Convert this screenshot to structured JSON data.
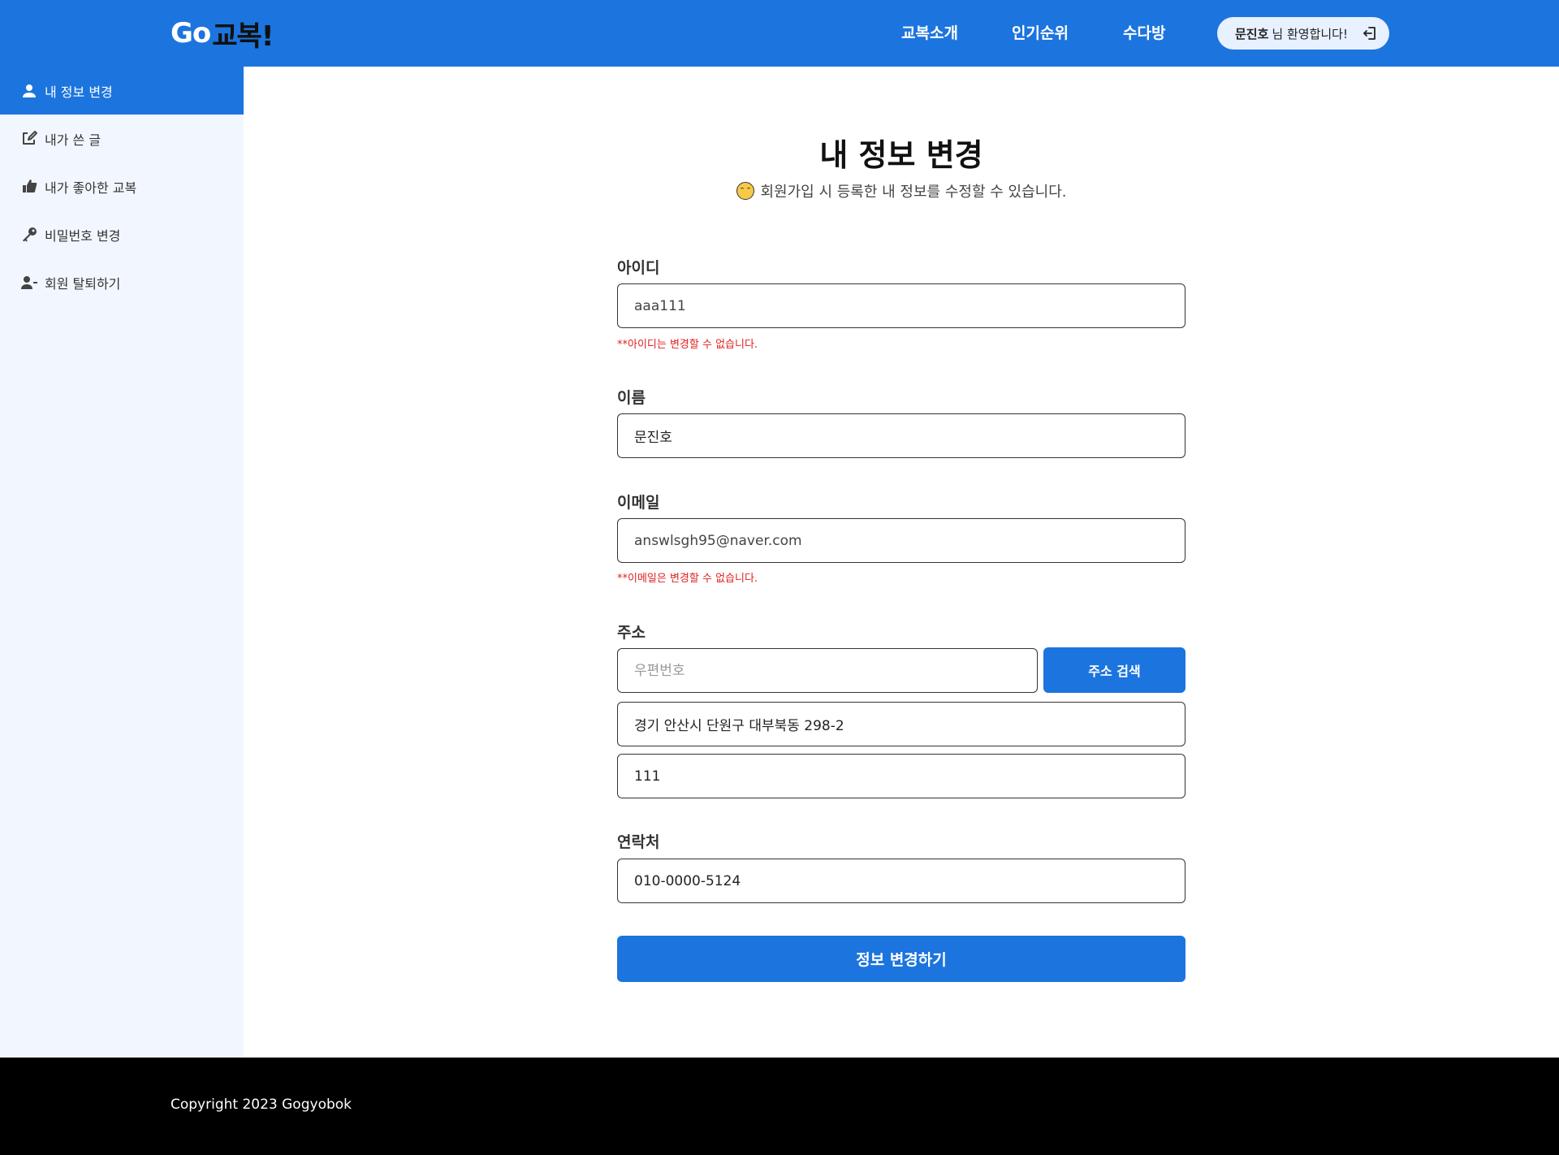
{
  "header": {
    "logo_go": "Go",
    "logo_kor": "교복!",
    "nav": [
      "교복소개",
      "인기순위",
      "수다방"
    ],
    "user_name": "문진호",
    "welcome_text": "님 환영합니다!",
    "logout_icon": "logout-icon"
  },
  "sidebar": {
    "items": [
      {
        "label": "내 정보 변경",
        "icon": "user-icon",
        "active": true
      },
      {
        "label": "내가 쓴 글",
        "icon": "edit-icon",
        "active": false
      },
      {
        "label": "내가 좋아한 교복",
        "icon": "thumbs-up-icon",
        "active": false
      },
      {
        "label": "비밀번호 변경",
        "icon": "key-icon",
        "active": false
      },
      {
        "label": "회원 탈퇴하기",
        "icon": "user-minus-icon",
        "active": false
      }
    ]
  },
  "main": {
    "title": "내 정보 변경",
    "subtitle": "회원가입 시 등록한 내 정보를 수정할 수 있습니다.",
    "id_label": "아이디",
    "id_value": "aaa111",
    "id_note": "**아이디는 변경할 수 없습니다.",
    "name_label": "이름",
    "name_value": "문진호",
    "email_label": "이메일",
    "email_value": "answlsgh95@naver.com",
    "email_note": "**이메일은 변경할 수 없습니다.",
    "address_label": "주소",
    "postcode_placeholder": "우편번호",
    "address_search_button": "주소 검색",
    "address_value": "경기 안산시 단원구 대부북동 298-2",
    "address_detail_value": "111",
    "phone_label": "연락처",
    "phone_value": "010-0000-5124",
    "submit_button": "정보 변경하기"
  },
  "footer": {
    "copyright": "Copyright 2023 Gogyobok"
  },
  "colors": {
    "primary": "#1c74de",
    "sidebar_bg": "#f2f7ff",
    "error": "#e02020",
    "footer_bg": "#000000"
  }
}
